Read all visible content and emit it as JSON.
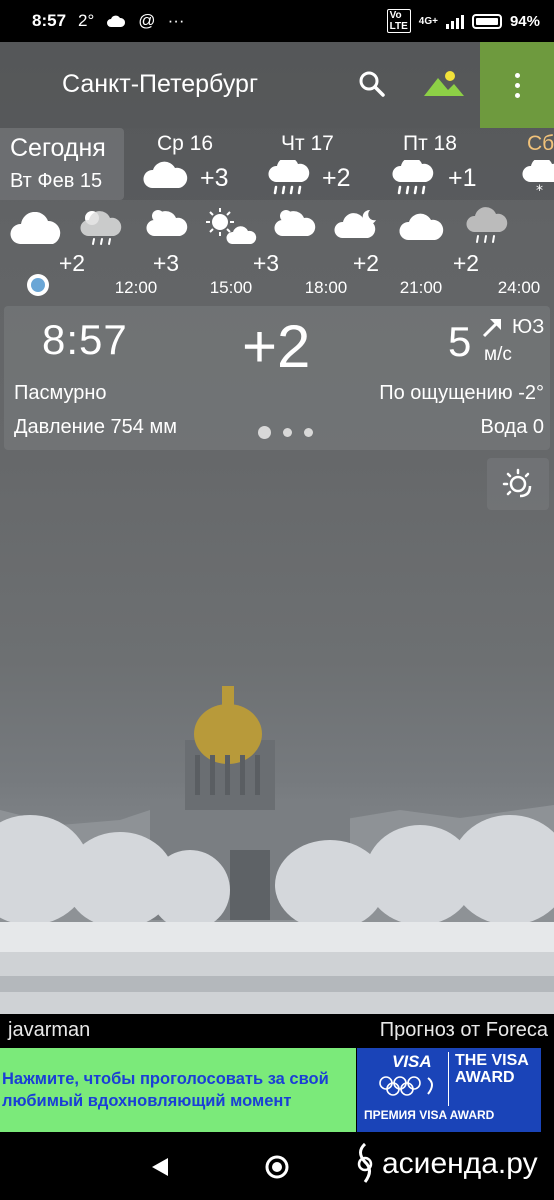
{
  "status_bar": {
    "time": "8:57",
    "temp_indicator": "2°",
    "network": "4G+",
    "battery": "94%",
    "icons": [
      "cloud-icon",
      "at-icon",
      "more-dots-icon",
      "volte-icon",
      "signal-icon",
      "battery-icon"
    ]
  },
  "header": {
    "city": "Санкт-Петербург",
    "search_icon": "search-icon",
    "background_icon": "landscape-icon",
    "menu_icon": "more-vertical-icon",
    "menu_color": "#6e9a3e"
  },
  "days": {
    "today_label": "Сегодня",
    "today_date": "Вт Фев 15",
    "items": [
      {
        "label": "Ср 16",
        "temp": "+3",
        "icon": "cloud-icon"
      },
      {
        "label": "Чт 17",
        "temp": "+2",
        "icon": "rain-cloud-icon"
      },
      {
        "label": "Пт 18",
        "temp": "+1",
        "icon": "rain-cloud-icon"
      },
      {
        "label": "Сб",
        "temp": "",
        "icon": "snow-cloud-icon",
        "color": "#f1c27a"
      }
    ]
  },
  "hourly": {
    "items": [
      {
        "temp": "+2",
        "icon": "cloud-icon",
        "time": ""
      },
      {
        "temp": "+3",
        "icon": "sun-rain-cloud-icon",
        "time": "12:00"
      },
      {
        "temp": "+3",
        "icon": "sun-cloud-icon",
        "time": "15:00"
      },
      {
        "temp": "+2",
        "icon": "sun-cloud-icon",
        "time": "18:00"
      },
      {
        "temp": "+2",
        "icon": "moon-cloud-icon",
        "time": "21:00"
      },
      {
        "temp": "",
        "icon": "rain-cloud-icon",
        "time": "24:00"
      }
    ],
    "extra_icons": [
      "sun-partly-cloud-icon",
      "cloud-icon"
    ]
  },
  "current": {
    "time": "8:57",
    "temp": "+2",
    "wind_speed": "5",
    "wind_dir": "ЮЗ",
    "wind_unit": "м/с",
    "condition": "Пасмурно",
    "feels_like": "По ощущению -2°",
    "pressure": "Давление 754 мм",
    "water": "Вода 0",
    "page_count": 3,
    "active_page": 1
  },
  "sun_button_icon": "sun-haze-icon",
  "credits": {
    "photo_author": "javarman",
    "forecast_source": "Прогноз от Foreca"
  },
  "ad": {
    "text": "Нажмите, чтобы проголосовать за свой любимый вдохновляющий момент",
    "brand": "VISA",
    "award_title": "THE VISA AWARD",
    "award_sub": "ПРЕМИЯ VISA AWARD",
    "green": "#7bea7a",
    "blue": "#1a44b8"
  },
  "navbar": {
    "back_icon": "back-triangle-icon",
    "home_icon": "home-circle-icon",
    "watermark": "асиенда.ру"
  }
}
